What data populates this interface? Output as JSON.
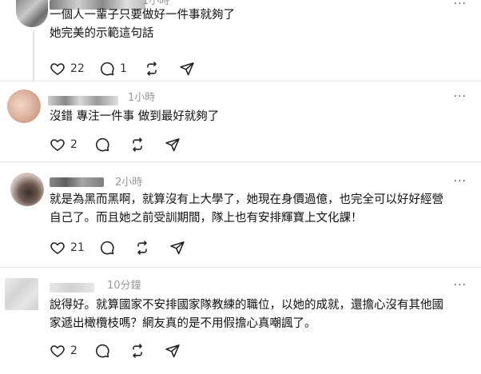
{
  "comments": [
    {
      "time": "1小時",
      "lines": [
        "一個人一輩子只要做好一件事就夠了",
        "她完美的示範這句話"
      ],
      "likes": "22",
      "replies": "1",
      "reposts": "",
      "more": "···"
    },
    {
      "time": "1小時",
      "lines": [
        "沒錯 專注一件事 做到最好就夠了"
      ],
      "likes": "2",
      "replies": "",
      "reposts": "",
      "more": "···"
    },
    {
      "time": "2小時",
      "lines": [
        "就是為黑而黑啊，就算沒有上大學了，她現在身價過億，也完全可以好好經營",
        "自己了。而且她之前受訓期間，隊上也有安排輝寶上文化課！"
      ],
      "likes": "21",
      "replies": "",
      "reposts": "",
      "more": "···"
    },
    {
      "time": "10分鐘",
      "lines": [
        "說得好。就算國家不安排國家隊教練的職位，以她的成就，還擔心沒有其他國",
        "家遞出橄欖枝嗎？網友真的是不用假擔心真嘲諷了。"
      ],
      "likes": "2",
      "replies": "",
      "reposts": "",
      "more": "···"
    }
  ],
  "icons": {
    "like": "heart-icon",
    "reply": "comment-icon",
    "repost": "repost-icon",
    "share": "send-icon",
    "more": "more-icon"
  },
  "colors": {
    "text": "#101010",
    "muted": "#999999",
    "divider": "#e6e6e6"
  }
}
